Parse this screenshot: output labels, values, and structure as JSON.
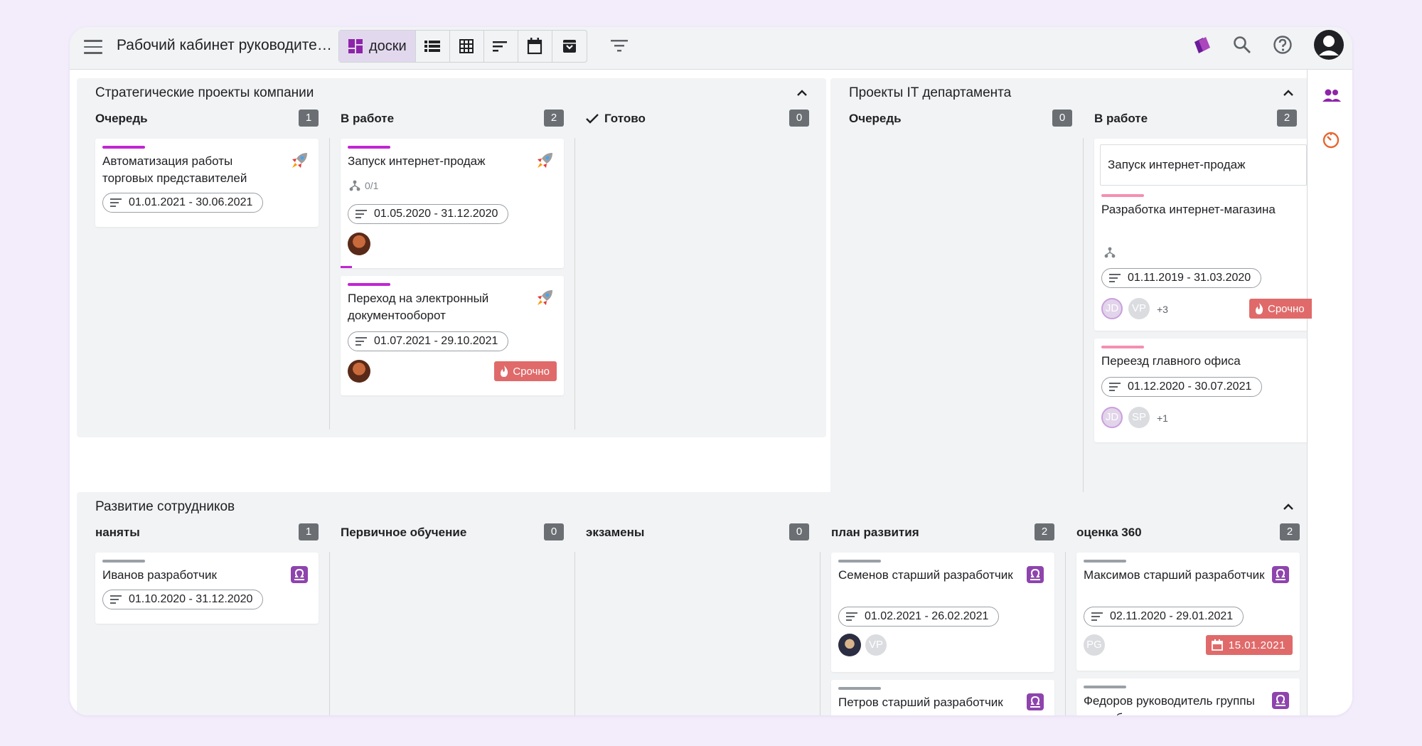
{
  "app": {
    "title": "Рабочий кабинет руководите…",
    "views": [
      {
        "name": "boards",
        "label": "доски",
        "active": true,
        "icon": "boards-icon"
      },
      {
        "name": "list",
        "label": "",
        "icon": "list-icon"
      },
      {
        "name": "table",
        "label": "",
        "icon": "table-icon"
      },
      {
        "name": "gantt",
        "label": "",
        "icon": "gantt-icon"
      },
      {
        "name": "calendar",
        "label": "",
        "icon": "calendar-icon"
      },
      {
        "name": "archive",
        "label": "",
        "icon": "archive-icon"
      }
    ],
    "accent": "#8e24aa"
  },
  "boards": {
    "strategic": {
      "title": "Стратегические проекты компании",
      "columns": [
        {
          "name": "Очередь",
          "count": "1"
        },
        {
          "name": "В работе",
          "count": "2"
        },
        {
          "name": "Готово",
          "count": "0"
        }
      ],
      "cards": [
        {
          "title": "Автоматизация работы торговых представителей",
          "dates": "01.01.2021 - 30.06.2021",
          "icon": "rocket-icon",
          "bar_color": "#c026d3"
        },
        {
          "title": "Запуск интернет-продаж",
          "subtasks": "0/1",
          "dates": "01.05.2020 - 31.12.2020",
          "icon": "rocket-icon",
          "bar_color": "#c026d3",
          "progress": 0.05
        },
        {
          "title": "Переход на электронный документооборот",
          "dates": "01.07.2021 - 29.10.2021",
          "icon": "rocket-icon",
          "bar_color": "#c026d3",
          "badge": "Срочно"
        }
      ]
    },
    "it": {
      "title": "Проекты IT департамента",
      "columns": [
        {
          "name": "Очередь",
          "count": "0"
        },
        {
          "name": "В работе",
          "count": "2"
        }
      ],
      "parent": "Запуск интернет-продаж",
      "cards": [
        {
          "title": "Разработка интернет-магазина",
          "dates": "01.11.2019 - 31.03.2020",
          "bar_color": "#f48fb1",
          "assignees": [
            "JD",
            "VP"
          ],
          "more": "+3",
          "badge": "Срочно"
        },
        {
          "title": "Переезд главного офиса",
          "dates": "01.12.2020 - 30.07.2021",
          "bar_color": "#f48fb1",
          "assignees": [
            "JD",
            "SP"
          ],
          "more": "+1"
        }
      ]
    },
    "staff": {
      "title": "Развитие сотрудников",
      "columns": [
        {
          "name": "наняты",
          "count": "1"
        },
        {
          "name": "Первичное обучение",
          "count": "0"
        },
        {
          "name": "экзамены",
          "count": "0"
        },
        {
          "name": "план развития",
          "count": "2"
        },
        {
          "name": "оценка 360",
          "count": "2"
        }
      ],
      "cards": [
        {
          "title": "Иванов разработчик",
          "dates": "01.10.2020 - 31.12.2020",
          "bar_color": "#9aa0a6",
          "icon": "libra-icon"
        },
        {
          "title": "Семенов старший разработчик",
          "dates": "01.02.2021 - 26.02.2021",
          "bar_color": "#9aa0a6",
          "icon": "libra-icon",
          "assignees": [
            "VP"
          ]
        },
        {
          "title": "Петров старший разработчик",
          "bar_color": "#9aa0a6",
          "icon": "libra-icon"
        },
        {
          "title": "Максимов старший разработчик",
          "dates": "02.11.2020 - 29.01.2021",
          "bar_color": "#9aa0a6",
          "icon": "libra-icon",
          "assignees": [
            "PG"
          ],
          "due": "15.01.2021"
        },
        {
          "title": "Федоров руководитель группы разработчиков",
          "bar_color": "#9aa0a6",
          "icon": "libra-icon"
        }
      ]
    }
  }
}
